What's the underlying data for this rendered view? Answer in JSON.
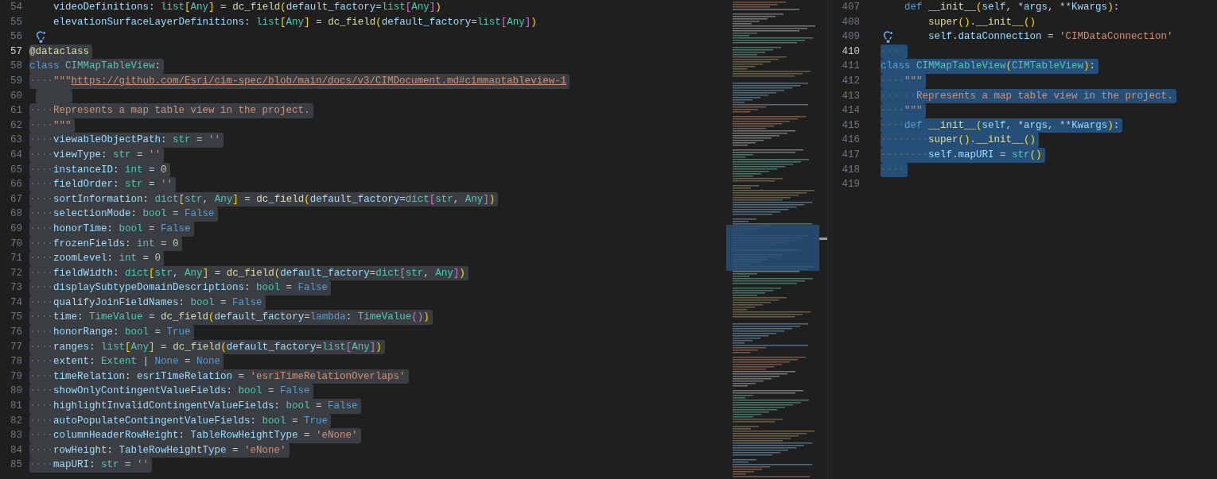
{
  "editors": [
    {
      "lines": [
        {
          "number": "54",
          "kind": "inner",
          "active": false,
          "selected": false,
          "hint": false,
          "tokens": [
            {
              "kind": "var",
              "text": "videoDefinitions"
            },
            {
              "kind": "plain",
              "text": ": "
            },
            {
              "kind": "type",
              "text": "list"
            },
            {
              "kind": "br1",
              "text": "["
            },
            {
              "kind": "type",
              "text": "Any"
            },
            {
              "kind": "br1",
              "text": "]"
            },
            {
              "kind": "plain",
              "text": " = "
            },
            {
              "kind": "fn",
              "text": "dc_field"
            },
            {
              "kind": "br1",
              "text": "("
            },
            {
              "kind": "var",
              "text": "default_factory"
            },
            {
              "kind": "plain",
              "text": "="
            },
            {
              "kind": "type",
              "text": "list"
            },
            {
              "kind": "br2",
              "text": "["
            },
            {
              "kind": "type",
              "text": "Any"
            },
            {
              "kind": "br2",
              "text": "]"
            },
            {
              "kind": "br1",
              "text": ")"
            }
          ]
        },
        {
          "number": "55",
          "kind": "inner",
          "active": false,
          "selected": false,
          "hint": false,
          "tokens": [
            {
              "kind": "var",
              "text": "elevationSurfaceLayerDefinitions"
            },
            {
              "kind": "plain",
              "text": ": "
            },
            {
              "kind": "type",
              "text": "list"
            },
            {
              "kind": "br1",
              "text": "["
            },
            {
              "kind": "type",
              "text": "Any"
            },
            {
              "kind": "br1",
              "text": "]"
            },
            {
              "kind": "plain",
              "text": " = "
            },
            {
              "kind": "fn",
              "text": "dc_field"
            },
            {
              "kind": "br1",
              "text": "("
            },
            {
              "kind": "var",
              "text": "default_factory"
            },
            {
              "kind": "plain",
              "text": "="
            },
            {
              "kind": "type",
              "text": "list"
            },
            {
              "kind": "br2",
              "text": "["
            },
            {
              "kind": "type",
              "text": "Any"
            },
            {
              "kind": "br2",
              "text": "]"
            },
            {
              "kind": "br1",
              "text": ")"
            }
          ]
        },
        {
          "number": "56",
          "kind": "flush",
          "active": false,
          "selected": false,
          "hint": true
        },
        {
          "number": "57",
          "kind": "flush",
          "active": true,
          "selected": true,
          "hint": false,
          "tokens": [
            {
              "kind": "fn",
              "text": "@dataclass"
            }
          ]
        },
        {
          "number": "58",
          "kind": "flush",
          "active": false,
          "selected": true,
          "hint": false,
          "tokens": [
            {
              "kind": "kw",
              "text": "class "
            },
            {
              "kind": "type",
              "text": "CIMMapTableView"
            },
            {
              "kind": "plain",
              "text": ":"
            }
          ]
        },
        {
          "number": "59",
          "kind": "flush",
          "active": false,
          "selected": true,
          "hint": false,
          "tokens": [
            {
              "kind": "ws",
              "text": "····"
            },
            {
              "kind": "str",
              "text": "\"\"\""
            },
            {
              "kind": "link",
              "text": "https://github.com/Esri/cim-spec/blob/main/docs/v3/CIMDocument.md#cimmaptableview-1"
            }
          ]
        },
        {
          "number": "60",
          "kind": "flush",
          "active": false,
          "selected": true,
          "hint": false
        },
        {
          "number": "61",
          "kind": "flush",
          "active": false,
          "selected": true,
          "hint": false,
          "tokens": [
            {
              "kind": "ws",
              "text": "····"
            },
            {
              "kind": "str",
              "text": "Represents a map table view in the project."
            }
          ]
        },
        {
          "number": "62",
          "kind": "flush",
          "active": false,
          "selected": true,
          "hint": false,
          "tokens": [
            {
              "kind": "ws",
              "text": "····"
            },
            {
              "kind": "str",
              "text": "\"\"\""
            }
          ]
        },
        {
          "number": "63",
          "kind": "flush",
          "active": false,
          "selected": true,
          "hint": false,
          "tokens": [
            {
              "kind": "ws",
              "text": "····"
            },
            {
              "kind": "var",
              "text": "viewableObjectPath"
            },
            {
              "kind": "plain",
              "text": ": "
            },
            {
              "kind": "type",
              "text": "str"
            },
            {
              "kind": "plain",
              "text": " = "
            },
            {
              "kind": "str",
              "text": "''"
            }
          ]
        },
        {
          "number": "64",
          "kind": "flush",
          "active": false,
          "selected": true,
          "hint": false,
          "tokens": [
            {
              "kind": "ws",
              "text": "····"
            },
            {
              "kind": "var",
              "text": "viewType"
            },
            {
              "kind": "plain",
              "text": ": "
            },
            {
              "kind": "type",
              "text": "str"
            },
            {
              "kind": "plain",
              "text": " = "
            },
            {
              "kind": "str",
              "text": "''"
            }
          ]
        },
        {
          "number": "65",
          "kind": "flush",
          "active": false,
          "selected": true,
          "hint": false,
          "tokens": [
            {
              "kind": "ws",
              "text": "····"
            },
            {
              "kind": "var",
              "text": "instanceID"
            },
            {
              "kind": "plain",
              "text": ": "
            },
            {
              "kind": "type",
              "text": "int"
            },
            {
              "kind": "plain",
              "text": " = "
            },
            {
              "kind": "num",
              "text": "0"
            }
          ]
        },
        {
          "number": "66",
          "kind": "flush",
          "active": false,
          "selected": true,
          "hint": false,
          "tokens": [
            {
              "kind": "ws",
              "text": "····"
            },
            {
              "kind": "var",
              "text": "fieldOrder"
            },
            {
              "kind": "plain",
              "text": ": "
            },
            {
              "kind": "type",
              "text": "str"
            },
            {
              "kind": "plain",
              "text": " = "
            },
            {
              "kind": "str",
              "text": "''"
            }
          ]
        },
        {
          "number": "67",
          "kind": "flush",
          "active": false,
          "selected": true,
          "hint": false,
          "tokens": [
            {
              "kind": "ws",
              "text": "····"
            },
            {
              "kind": "var",
              "text": "sortInformation"
            },
            {
              "kind": "plain",
              "text": ": "
            },
            {
              "kind": "type",
              "text": "dict"
            },
            {
              "kind": "br1",
              "text": "["
            },
            {
              "kind": "type",
              "text": "str"
            },
            {
              "kind": "plain",
              "text": ", "
            },
            {
              "kind": "type",
              "text": "Any"
            },
            {
              "kind": "br1",
              "text": "]"
            },
            {
              "kind": "plain",
              "text": " = "
            },
            {
              "kind": "fn",
              "text": "dc_field"
            },
            {
              "kind": "br1",
              "text": "("
            },
            {
              "kind": "var",
              "text": "default_factory"
            },
            {
              "kind": "plain",
              "text": "="
            },
            {
              "kind": "type",
              "text": "dict"
            },
            {
              "kind": "br2",
              "text": "["
            },
            {
              "kind": "type",
              "text": "str"
            },
            {
              "kind": "plain",
              "text": ", "
            },
            {
              "kind": "type",
              "text": "Any"
            },
            {
              "kind": "br2",
              "text": "]"
            },
            {
              "kind": "br1",
              "text": ")"
            }
          ]
        },
        {
          "number": "68",
          "kind": "flush",
          "active": false,
          "selected": true,
          "hint": false,
          "tokens": [
            {
              "kind": "ws",
              "text": "····"
            },
            {
              "kind": "var",
              "text": "selectionMode"
            },
            {
              "kind": "plain",
              "text": ": "
            },
            {
              "kind": "type",
              "text": "bool"
            },
            {
              "kind": "plain",
              "text": " = "
            },
            {
              "kind": "kw",
              "text": "False"
            }
          ]
        },
        {
          "number": "69",
          "kind": "flush",
          "active": false,
          "selected": true,
          "hint": false,
          "tokens": [
            {
              "kind": "ws",
              "text": "····"
            },
            {
              "kind": "var",
              "text": "honorTime"
            },
            {
              "kind": "plain",
              "text": ": "
            },
            {
              "kind": "type",
              "text": "bool"
            },
            {
              "kind": "plain",
              "text": " = "
            },
            {
              "kind": "kw",
              "text": "False"
            }
          ]
        },
        {
          "number": "70",
          "kind": "flush",
          "active": false,
          "selected": true,
          "hint": false,
          "tokens": [
            {
              "kind": "ws",
              "text": "····"
            },
            {
              "kind": "var",
              "text": "frozenFields"
            },
            {
              "kind": "plain",
              "text": ": "
            },
            {
              "kind": "type",
              "text": "int"
            },
            {
              "kind": "plain",
              "text": " = "
            },
            {
              "kind": "num",
              "text": "0"
            }
          ]
        },
        {
          "number": "71",
          "kind": "flush",
          "active": false,
          "selected": true,
          "hint": false,
          "tokens": [
            {
              "kind": "ws",
              "text": "····"
            },
            {
              "kind": "var",
              "text": "zoomLevel"
            },
            {
              "kind": "plain",
              "text": ": "
            },
            {
              "kind": "type",
              "text": "int"
            },
            {
              "kind": "plain",
              "text": " = "
            },
            {
              "kind": "num",
              "text": "0"
            }
          ]
        },
        {
          "number": "72",
          "kind": "flush",
          "active": false,
          "selected": true,
          "hint": false,
          "tokens": [
            {
              "kind": "ws",
              "text": "····"
            },
            {
              "kind": "var",
              "text": "fieldWidth"
            },
            {
              "kind": "plain",
              "text": ": "
            },
            {
              "kind": "type",
              "text": "dict"
            },
            {
              "kind": "br1",
              "text": "["
            },
            {
              "kind": "type",
              "text": "str"
            },
            {
              "kind": "plain",
              "text": ", "
            },
            {
              "kind": "type",
              "text": "Any"
            },
            {
              "kind": "br1",
              "text": "]"
            },
            {
              "kind": "plain",
              "text": " = "
            },
            {
              "kind": "fn",
              "text": "dc_field"
            },
            {
              "kind": "br1",
              "text": "("
            },
            {
              "kind": "var",
              "text": "default_factory"
            },
            {
              "kind": "plain",
              "text": "="
            },
            {
              "kind": "type",
              "text": "dict"
            },
            {
              "kind": "br2",
              "text": "["
            },
            {
              "kind": "type",
              "text": "str"
            },
            {
              "kind": "plain",
              "text": ", "
            },
            {
              "kind": "type",
              "text": "Any"
            },
            {
              "kind": "br2",
              "text": "]"
            },
            {
              "kind": "br1",
              "text": ")"
            }
          ]
        },
        {
          "number": "73",
          "kind": "flush",
          "active": false,
          "selected": true,
          "hint": false,
          "tokens": [
            {
              "kind": "ws",
              "text": "····"
            },
            {
              "kind": "var",
              "text": "displaySubtypeDomainDescriptions"
            },
            {
              "kind": "plain",
              "text": ": "
            },
            {
              "kind": "type",
              "text": "bool"
            },
            {
              "kind": "plain",
              "text": " = "
            },
            {
              "kind": "kw",
              "text": "False"
            }
          ]
        },
        {
          "number": "74",
          "kind": "flush",
          "active": false,
          "selected": true,
          "hint": false,
          "tokens": [
            {
              "kind": "ws",
              "text": "····"
            },
            {
              "kind": "var",
              "text": "qualifyJoinFieldNames"
            },
            {
              "kind": "plain",
              "text": ": "
            },
            {
              "kind": "type",
              "text": "bool"
            },
            {
              "kind": "plain",
              "text": " = "
            },
            {
              "kind": "kw",
              "text": "False"
            }
          ]
        },
        {
          "number": "75",
          "kind": "flush",
          "active": false,
          "selected": true,
          "hint": false,
          "tokens": [
            {
              "kind": "ws",
              "text": "····"
            },
            {
              "kind": "var",
              "text": "time"
            },
            {
              "kind": "plain",
              "text": ": "
            },
            {
              "kind": "type",
              "text": "TimeValue"
            },
            {
              "kind": "plain",
              "text": " = "
            },
            {
              "kind": "fn",
              "text": "dc_field"
            },
            {
              "kind": "br1",
              "text": "("
            },
            {
              "kind": "var",
              "text": "default_factory"
            },
            {
              "kind": "plain",
              "text": "="
            },
            {
              "kind": "kw",
              "text": "lambda"
            },
            {
              "kind": "plain",
              "text": ": "
            },
            {
              "kind": "type",
              "text": "TimeValue"
            },
            {
              "kind": "br2",
              "text": "()"
            },
            {
              "kind": "br1",
              "text": ")"
            }
          ]
        },
        {
          "number": "76",
          "kind": "flush",
          "active": false,
          "selected": true,
          "hint": false,
          "tokens": [
            {
              "kind": "ws",
              "text": "····"
            },
            {
              "kind": "var",
              "text": "honorRange"
            },
            {
              "kind": "plain",
              "text": ": "
            },
            {
              "kind": "type",
              "text": "bool"
            },
            {
              "kind": "plain",
              "text": " = "
            },
            {
              "kind": "kw",
              "text": "True"
            }
          ]
        },
        {
          "number": "77",
          "kind": "flush",
          "active": false,
          "selected": true,
          "hint": false,
          "tokens": [
            {
              "kind": "ws",
              "text": "····"
            },
            {
              "kind": "var",
              "text": "ranges"
            },
            {
              "kind": "plain",
              "text": ": "
            },
            {
              "kind": "type",
              "text": "list"
            },
            {
              "kind": "br1",
              "text": "["
            },
            {
              "kind": "type",
              "text": "Any"
            },
            {
              "kind": "br1",
              "text": "]"
            },
            {
              "kind": "plain",
              "text": " = "
            },
            {
              "kind": "fn",
              "text": "dc_field"
            },
            {
              "kind": "br1",
              "text": "("
            },
            {
              "kind": "var",
              "text": "default_factory"
            },
            {
              "kind": "plain",
              "text": "="
            },
            {
              "kind": "type",
              "text": "list"
            },
            {
              "kind": "br2",
              "text": "["
            },
            {
              "kind": "type",
              "text": "Any"
            },
            {
              "kind": "br2",
              "text": "]"
            },
            {
              "kind": "br1",
              "text": ")"
            }
          ]
        },
        {
          "number": "78",
          "kind": "flush",
          "active": false,
          "selected": true,
          "hint": false,
          "tokens": [
            {
              "kind": "ws",
              "text": "····"
            },
            {
              "kind": "var",
              "text": "extent"
            },
            {
              "kind": "plain",
              "text": ": "
            },
            {
              "kind": "type",
              "text": "Extent"
            },
            {
              "kind": "plain",
              "text": " | "
            },
            {
              "kind": "kw",
              "text": "None"
            },
            {
              "kind": "plain",
              "text": " = "
            },
            {
              "kind": "kw",
              "text": "None"
            }
          ]
        },
        {
          "number": "79",
          "kind": "flush",
          "active": false,
          "selected": true,
          "hint": false,
          "tokens": [
            {
              "kind": "ws",
              "text": "····"
            },
            {
              "kind": "var",
              "text": "timeRelation"
            },
            {
              "kind": "plain",
              "text": ": "
            },
            {
              "kind": "var",
              "text": "esriTimeRelation"
            },
            {
              "kind": "plain",
              "text": " = "
            },
            {
              "kind": "str",
              "text": "'esriTimeRelationOverlaps'"
            }
          ]
        },
        {
          "number": "80",
          "kind": "flush",
          "active": false,
          "selected": true,
          "hint": false,
          "tokens": [
            {
              "kind": "ws",
              "text": "····"
            },
            {
              "kind": "var",
              "text": "showOnlyContingentValueFields"
            },
            {
              "kind": "plain",
              "text": ": "
            },
            {
              "kind": "type",
              "text": "bool"
            },
            {
              "kind": "plain",
              "text": " = "
            },
            {
              "kind": "kw",
              "text": "False"
            }
          ]
        },
        {
          "number": "81",
          "kind": "flush",
          "active": false,
          "selected": true,
          "hint": false,
          "tokens": [
            {
              "kind": "ws",
              "text": "····"
            },
            {
              "kind": "var",
              "text": "highlightInvalidContingentValueFields"
            },
            {
              "kind": "plain",
              "text": ": "
            },
            {
              "kind": "type",
              "text": "bool"
            },
            {
              "kind": "plain",
              "text": " = "
            },
            {
              "kind": "kw",
              "text": "False"
            }
          ]
        },
        {
          "number": "82",
          "kind": "flush",
          "active": false,
          "selected": true,
          "hint": false,
          "tokens": [
            {
              "kind": "ws",
              "text": "····"
            },
            {
              "kind": "var",
              "text": "autoPopulateContingentValueFields"
            },
            {
              "kind": "plain",
              "text": ": "
            },
            {
              "kind": "type",
              "text": "bool"
            },
            {
              "kind": "plain",
              "text": " = "
            },
            {
              "kind": "kw",
              "text": "True"
            }
          ]
        },
        {
          "number": "83",
          "kind": "flush",
          "active": false,
          "selected": true,
          "hint": false,
          "tokens": [
            {
              "kind": "ws",
              "text": "····"
            },
            {
              "kind": "var",
              "text": "columnHeaderRowHeight"
            },
            {
              "kind": "plain",
              "text": ": "
            },
            {
              "kind": "var",
              "text": "TableRowHeightType"
            },
            {
              "kind": "plain",
              "text": " = "
            },
            {
              "kind": "str",
              "text": "'eNone'"
            }
          ]
        },
        {
          "number": "84",
          "kind": "flush",
          "active": false,
          "selected": true,
          "hint": false,
          "tokens": [
            {
              "kind": "ws",
              "text": "····"
            },
            {
              "kind": "var",
              "text": "rowHeight"
            },
            {
              "kind": "plain",
              "text": ": "
            },
            {
              "kind": "var",
              "text": "TableRowHeightType"
            },
            {
              "kind": "plain",
              "text": " = "
            },
            {
              "kind": "str",
              "text": "'eNone'"
            }
          ]
        },
        {
          "number": "85",
          "kind": "flush",
          "active": false,
          "selected": true,
          "hint": false,
          "tokens": [
            {
              "kind": "ws",
              "text": "····"
            },
            {
              "kind": "var",
              "text": "mapURI"
            },
            {
              "kind": "plain",
              "text": ": "
            },
            {
              "kind": "type",
              "text": "str"
            },
            {
              "kind": "plain",
              "text": " = "
            },
            {
              "kind": "str",
              "text": "''"
            }
          ]
        }
      ]
    },
    {
      "lines": [
        {
          "number": "407",
          "kind": "inner",
          "active": false,
          "selected": false,
          "hint": false,
          "tokens": [
            {
              "kind": "kw",
              "text": "def "
            },
            {
              "kind": "fn",
              "text": "__init__"
            },
            {
              "kind": "br1",
              "text": "("
            },
            {
              "kind": "var",
              "text": "self"
            },
            {
              "kind": "plain",
              "text": ", *"
            },
            {
              "kind": "var",
              "text": "args"
            },
            {
              "kind": "plain",
              "text": ", **"
            },
            {
              "kind": "var",
              "text": "Kwargs"
            },
            {
              "kind": "br1",
              "text": ")"
            },
            {
              "kind": "plain",
              "text": ":"
            }
          ]
        },
        {
          "number": "408",
          "kind": "deep",
          "active": false,
          "selected": false,
          "hint": false,
          "tokens": [
            {
              "kind": "fn",
              "text": "super"
            },
            {
              "kind": "br1",
              "text": "()"
            },
            {
              "kind": "plain",
              "text": "."
            },
            {
              "kind": "fn",
              "text": "__init__"
            },
            {
              "kind": "br1",
              "text": "()"
            }
          ]
        },
        {
          "number": "409",
          "kind": "deep",
          "active": false,
          "selected": false,
          "hint": true,
          "tokens": [
            {
              "kind": "var",
              "text": "self"
            },
            {
              "kind": "plain",
              "text": "."
            },
            {
              "kind": "var",
              "text": "dataConnection"
            },
            {
              "kind": "plain",
              "text": " = "
            },
            {
              "kind": "str",
              "text": "'CIMDataConnection'"
            }
          ]
        },
        {
          "number": "410",
          "kind": "flush",
          "active": true,
          "selected": true,
          "hint": false,
          "tokens": [
            {
              "kind": "ws",
              "text": "····"
            }
          ]
        },
        {
          "number": "411",
          "kind": "flush",
          "active": false,
          "selected": true,
          "hint": false,
          "tokens": [
            {
              "kind": "kw",
              "text": "class "
            },
            {
              "kind": "type",
              "text": "CIMMapTableView"
            },
            {
              "kind": "br1",
              "text": "("
            },
            {
              "kind": "type",
              "text": "CIMTableView"
            },
            {
              "kind": "br1",
              "text": ")"
            },
            {
              "kind": "plain",
              "text": ":"
            }
          ]
        },
        {
          "number": "412",
          "kind": "flush",
          "active": false,
          "selected": true,
          "hint": false,
          "tokens": [
            {
              "kind": "ws",
              "text": "····"
            },
            {
              "kind": "str",
              "text": "\"\"\""
            }
          ]
        },
        {
          "number": "413",
          "kind": "flush",
          "active": false,
          "selected": true,
          "hint": false,
          "tokens": [
            {
              "kind": "ws",
              "text": "······"
            },
            {
              "kind": "str",
              "text": "Represents a map table view in the project."
            }
          ]
        },
        {
          "number": "414",
          "kind": "flush",
          "active": false,
          "selected": true,
          "hint": false,
          "tokens": [
            {
              "kind": "ws",
              "text": "····"
            },
            {
              "kind": "str",
              "text": "\"\"\""
            }
          ]
        },
        {
          "number": "415",
          "kind": "flush",
          "active": false,
          "selected": true,
          "hint": false,
          "tokens": [
            {
              "kind": "ws",
              "text": "····"
            },
            {
              "kind": "kw",
              "text": "def "
            },
            {
              "kind": "fn",
              "text": "__init__"
            },
            {
              "kind": "br1",
              "text": "("
            },
            {
              "kind": "var",
              "text": "self"
            },
            {
              "kind": "plain",
              "text": ", *"
            },
            {
              "kind": "var",
              "text": "args"
            },
            {
              "kind": "plain",
              "text": ", **"
            },
            {
              "kind": "var",
              "text": "Kwargs"
            },
            {
              "kind": "br1",
              "text": ")"
            },
            {
              "kind": "plain",
              "text": ":"
            }
          ]
        },
        {
          "number": "416",
          "kind": "flush",
          "active": false,
          "selected": true,
          "hint": false,
          "tokens": [
            {
              "kind": "ws",
              "text": "········"
            },
            {
              "kind": "fn",
              "text": "super"
            },
            {
              "kind": "br1",
              "text": "()"
            },
            {
              "kind": "plain",
              "text": "."
            },
            {
              "kind": "fn",
              "text": "__init__"
            },
            {
              "kind": "br1",
              "text": "()"
            }
          ]
        },
        {
          "number": "417",
          "kind": "flush",
          "active": false,
          "selected": true,
          "hint": false,
          "tokens": [
            {
              "kind": "ws",
              "text": "········"
            },
            {
              "kind": "var",
              "text": "self"
            },
            {
              "kind": "plain",
              "text": "."
            },
            {
              "kind": "var",
              "text": "mapURI"
            },
            {
              "kind": "plain",
              "text": " = "
            },
            {
              "kind": "type",
              "text": "str"
            },
            {
              "kind": "br1",
              "text": "()"
            }
          ]
        },
        {
          "number": "418",
          "kind": "flush",
          "active": false,
          "selected": true,
          "hint": false,
          "tokens": [
            {
              "kind": "ws",
              "text": "····"
            }
          ]
        },
        {
          "number": "419",
          "kind": "flush",
          "active": false,
          "selected": false,
          "hint": false
        }
      ]
    }
  ]
}
